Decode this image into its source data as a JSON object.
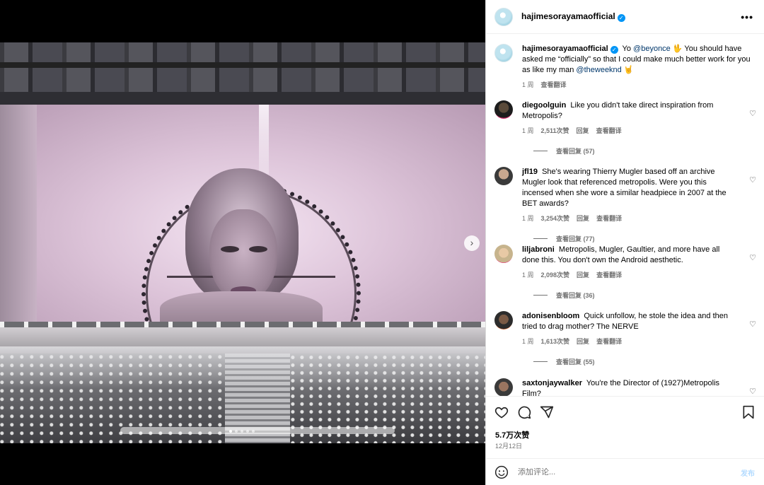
{
  "post": {
    "author": "hajimesorayamaofficial",
    "verified_mark": "✓",
    "caption_prefix": "Yo ",
    "mention1": "@beyonce",
    "caption_mid": " 🖖 You should have asked me “officially” so that I could make much better work for you as like my man ",
    "mention2": "@theweeknd",
    "caption_suffix": " 🤘",
    "age": "1 周",
    "translate": "查看翻译"
  },
  "comments": [
    {
      "user": "diegoolguin",
      "text": "Like you didn't take direct inspiration from Metropolis?",
      "age": "1 周",
      "likes": "2,511次赞",
      "reply": "回复",
      "translate": "查看翻译",
      "view_replies": "查看回复 (57)"
    },
    {
      "user": "jfl19",
      "text": "She's wearing Thierry Mugler based off an archive Mugler look that referenced metropolis. Were you this incensed when she wore a similar headpiece in 2007 at the BET awards?",
      "age": "1 周",
      "likes": "3,254次赞",
      "reply": "回复",
      "translate": "查看翻译",
      "view_replies": "查看回复 (77)"
    },
    {
      "user": "liljabroni",
      "text": "Metropolis, Mugler, Gaultier, and more have all done this. You don't own the Android aesthetic.",
      "age": "1 周",
      "likes": "2,098次赞",
      "reply": "回复",
      "translate": "查看翻译",
      "view_replies": "查看回复 (36)"
    },
    {
      "user": "adonisenbloom",
      "text": "Quick unfollow, he stole the idea and then tried to drag mother? The NERVE",
      "age": "1 周",
      "likes": "1,613次赞",
      "reply": "回复",
      "translate": "查看翻译",
      "view_replies": "查看回复 (55)"
    },
    {
      "user": "saxtonjaywalker",
      "text": "You're the Director of (1927)Metropolis Film?"
    }
  ],
  "stats": {
    "likes": "5.7万次赞",
    "date": "12月12日"
  },
  "composer": {
    "placeholder": "添加评论...",
    "post": "发布"
  },
  "icons": {
    "more": "more-icon",
    "heart": "heart-icon",
    "comment": "comment-icon",
    "share": "share-icon",
    "save": "bookmark-icon",
    "emoji": "emoji-icon",
    "next": "chevron-right-icon"
  },
  "colors": {
    "link": "#00376b",
    "verified": "#0095f6",
    "muted": "#737373",
    "post_button": "#b3dbff"
  }
}
